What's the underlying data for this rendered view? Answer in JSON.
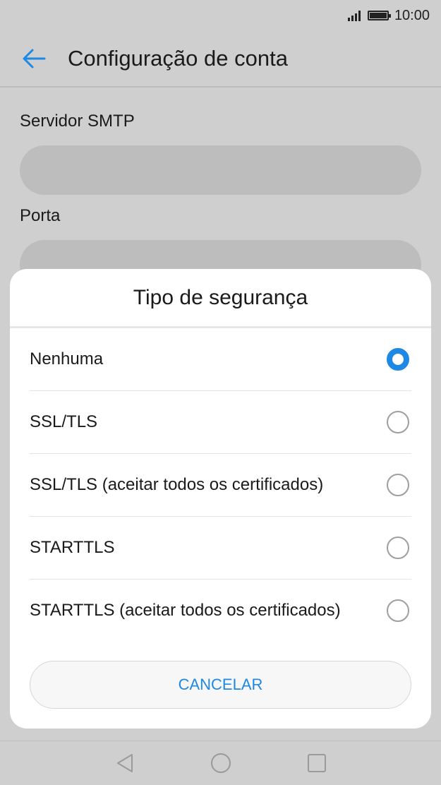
{
  "status_bar": {
    "time": "10:00",
    "icons": [
      "signal-icon",
      "battery-icon"
    ]
  },
  "app_bar": {
    "title": "Configuração de conta",
    "back_icon": "arrow-left-icon"
  },
  "form": {
    "smtp_label": "Servidor SMTP",
    "smtp_value": "",
    "port_label": "Porta",
    "port_value": ""
  },
  "dialog": {
    "title": "Tipo de segurança",
    "options": [
      {
        "label": "Nenhuma",
        "selected": true
      },
      {
        "label": "SSL/TLS",
        "selected": false
      },
      {
        "label": "SSL/TLS (aceitar todos os certificados)",
        "selected": false
      },
      {
        "label": "STARTTLS",
        "selected": false
      },
      {
        "label": "STARTTLS (aceitar todos os certificados)",
        "selected": false
      }
    ],
    "cancel_label": "CANCELAR"
  },
  "nav_bar": {
    "icons": [
      "back-triangle-icon",
      "home-circle-icon",
      "recents-square-icon"
    ]
  },
  "colors": {
    "accent": "#1e88e5",
    "scrim": "#cfcfcf"
  }
}
